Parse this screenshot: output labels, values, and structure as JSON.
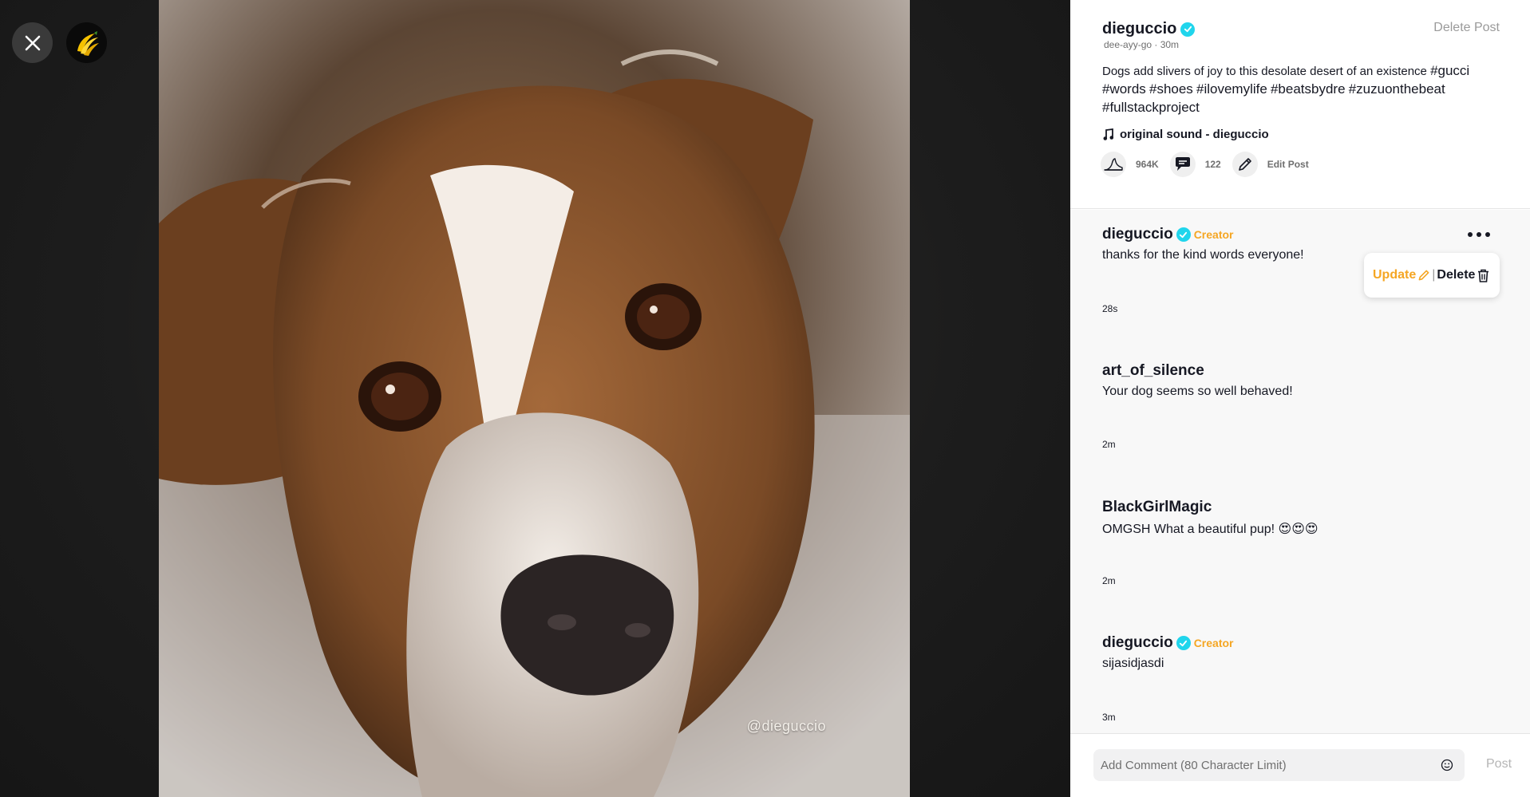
{
  "viewer": {
    "close_icon": "close-icon",
    "logo_icon": "banana-logo-icon",
    "watermark": "@dieguccio"
  },
  "post": {
    "author": "dieguccio",
    "meta": "dee-ayy-go · 30m",
    "delete_label": "Delete Post",
    "caption_text": "Dogs add slivers of joy to this desolate desert of an existence ",
    "hashtags": [
      "#gucci",
      "#words",
      "#shoes",
      "#ilovemylife",
      "#beatsbydre",
      "#zuzuonthebeat",
      "#fullstackproject"
    ],
    "sound": "original sound - dieguccio",
    "likes": "964K",
    "comments_count": "122",
    "edit_label": "Edit Post"
  },
  "comments": [
    {
      "user": "dieguccio",
      "verified": true,
      "badge": "Creator",
      "text": "thanks for the kind words everyone!",
      "time": "28s"
    },
    {
      "user": "art_of_silence",
      "verified": false,
      "badge": "",
      "text": "Your dog seems so well behaved!",
      "time": "2m"
    },
    {
      "user": "BlackGirlMagic",
      "verified": false,
      "badge": "",
      "text": "OMGSH What a beautiful pup! 😍😍😍",
      "time": "2m"
    },
    {
      "user": "dieguccio",
      "verified": true,
      "badge": "Creator",
      "text": "sijasidjasdi",
      "time": "3m"
    }
  ],
  "comment_menu": {
    "update_label": "Update",
    "delete_label": "Delete"
  },
  "composer": {
    "placeholder": "Add Comment (80 Character Limit)",
    "post_label": "Post"
  },
  "colors": {
    "verified": "#20d5ec",
    "creator": "#f5a623",
    "update": "#f5a623"
  }
}
